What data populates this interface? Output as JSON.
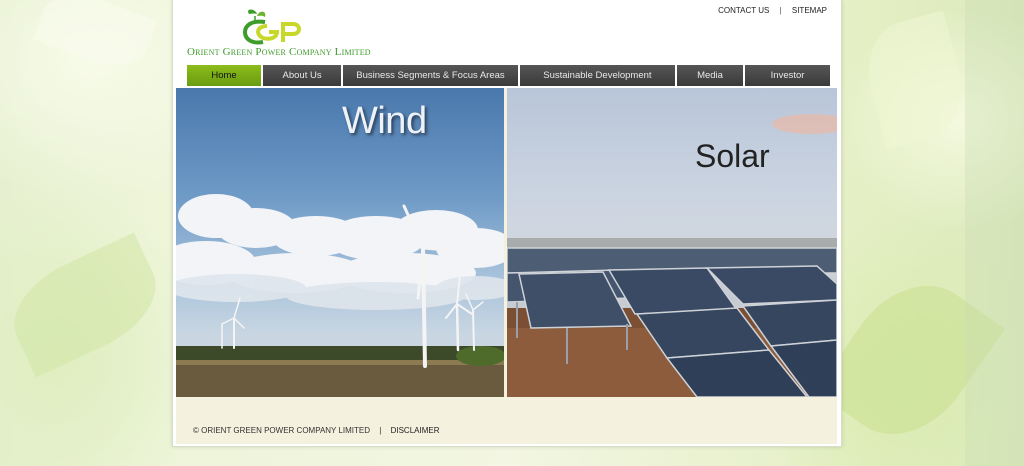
{
  "brand": {
    "logo_mark": "OGP",
    "company_name": "Orient Green Power Company Limited",
    "colors": {
      "logo_green": "#3d9c2a",
      "logo_yellow": "#c7d82a",
      "nav_active": "#7aab17",
      "nav_dark": "#474747"
    }
  },
  "top_links": {
    "contact": "CONTACT US",
    "separator": "|",
    "sitemap": "SITEMAP"
  },
  "nav": {
    "items": [
      {
        "label": "Home",
        "active": true
      },
      {
        "label": "About Us"
      },
      {
        "label": "Business Segments & Focus Areas"
      },
      {
        "label": "Sustainable Development"
      },
      {
        "label": "Media"
      },
      {
        "label": "Investor"
      }
    ]
  },
  "banner": {
    "wind": {
      "title": "Wind",
      "image": "wind-turbines-field-image"
    },
    "solar": {
      "title": "Solar",
      "image": "solar-panel-farm-image"
    }
  },
  "footer": {
    "copyright": "© ORIENT GREEN POWER COMPANY LIMITED",
    "separator": "|",
    "disclaimer": "DISCLAIMER"
  }
}
